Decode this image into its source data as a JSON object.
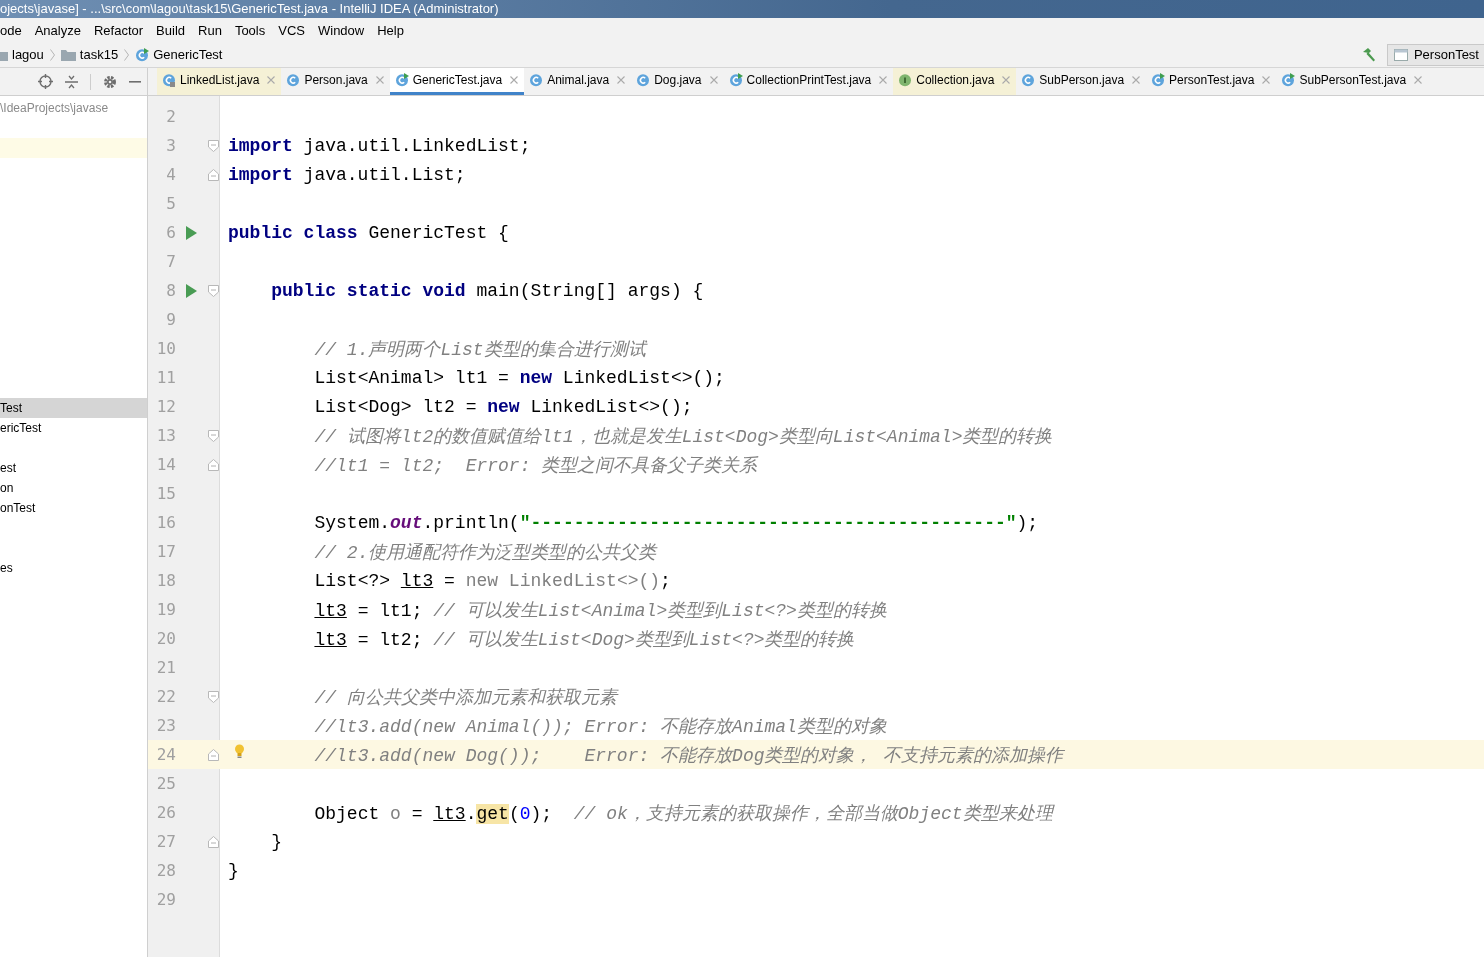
{
  "window": {
    "title": "ojects\\javase] - ...\\src\\com\\lagou\\task15\\GenericTest.java - IntelliJ IDEA (Administrator)"
  },
  "menu": [
    "ode",
    "Analyze",
    "Refactor",
    "Build",
    "Run",
    "Tools",
    "VCS",
    "Window",
    "Help"
  ],
  "breadcrumbs": [
    {
      "label": "lagou",
      "kind": "folder"
    },
    {
      "label": "task15",
      "kind": "folder"
    },
    {
      "label": "GenericTest",
      "kind": "runnable"
    }
  ],
  "run_config": {
    "label": "PersonTest"
  },
  "tabs": [
    {
      "label": "LinkedList.java",
      "kind": "locked",
      "library": true,
      "selected": false
    },
    {
      "label": "Person.java",
      "kind": "class",
      "library": false,
      "selected": false
    },
    {
      "label": "GenericTest.java",
      "kind": "runnable",
      "library": false,
      "selected": true
    },
    {
      "label": "Animal.java",
      "kind": "class",
      "library": false,
      "selected": false
    },
    {
      "label": "Dog.java",
      "kind": "class",
      "library": false,
      "selected": false
    },
    {
      "label": "CollectionPrintTest.java",
      "kind": "runnable",
      "library": false,
      "selected": false
    },
    {
      "label": "Collection.java",
      "kind": "interface",
      "library": true,
      "selected": false
    },
    {
      "label": "SubPerson.java",
      "kind": "class",
      "library": false,
      "selected": false
    },
    {
      "label": "PersonTest.java",
      "kind": "runnable",
      "library": false,
      "selected": false
    },
    {
      "label": "SubPersonTest.java",
      "kind": "runnable",
      "library": false,
      "selected": false
    }
  ],
  "sidebar": {
    "path": "\\IdeaProjects\\javase",
    "rows": [
      {
        "selected": false,
        "highlighted": true
      },
      {
        "label": "Test",
        "selected": true,
        "highlighted": false
      },
      {
        "label": "ericTest",
        "selected": false,
        "highlighted": false
      },
      {
        "label": "est",
        "selected": false,
        "highlighted": false
      },
      {
        "label": "on",
        "selected": false,
        "highlighted": false
      },
      {
        "label": "onTest",
        "selected": false,
        "highlighted": false
      },
      {
        "label": "es",
        "selected": false,
        "highlighted": false
      }
    ]
  },
  "code": {
    "lines": [
      {
        "number": "2",
        "run": false,
        "current": false,
        "bulb": false,
        "fold_start": false,
        "fold_end": false
      },
      {
        "number": "3",
        "run": false,
        "current": false,
        "bulb": false,
        "fold_start": true,
        "fold_end": false,
        "tokens": [
          {
            "t": "import",
            "kind": "kw"
          },
          {
            "t": " java.util.LinkedList;",
            "kind": "p"
          }
        ]
      },
      {
        "number": "4",
        "run": false,
        "current": false,
        "bulb": false,
        "fold_start": false,
        "fold_end": true,
        "tokens": [
          {
            "t": "import",
            "kind": "kw"
          },
          {
            "t": " java.util.List;",
            "kind": "p"
          }
        ]
      },
      {
        "number": "5",
        "run": false,
        "current": false,
        "bulb": false,
        "fold_start": false,
        "fold_end": false
      },
      {
        "number": "6",
        "run": true,
        "current": false,
        "bulb": false,
        "fold_start": false,
        "fold_end": false,
        "tokens": [
          {
            "t": "public class",
            "kind": "kw"
          },
          {
            "t": " GenericTest {",
            "kind": "p"
          }
        ]
      },
      {
        "number": "7",
        "run": false,
        "current": false,
        "bulb": false,
        "fold_start": false,
        "fold_end": false
      },
      {
        "number": "8",
        "run": true,
        "current": false,
        "bulb": false,
        "fold_start": true,
        "fold_end": false,
        "tokens": [
          {
            "t": "    public static void",
            "kind": "kw"
          },
          {
            "t": " main(String[] args) {",
            "kind": "p"
          }
        ]
      },
      {
        "number": "9",
        "run": false,
        "current": false,
        "bulb": false,
        "fold_start": false,
        "fold_end": false
      },
      {
        "number": "10",
        "run": false,
        "current": false,
        "bulb": false,
        "fold_start": false,
        "fold_end": false,
        "tokens": [
          {
            "t": "        // 1.声明两个List类型的集合进行测试",
            "kind": "c"
          }
        ]
      },
      {
        "number": "11",
        "run": false,
        "current": false,
        "bulb": false,
        "fold_start": false,
        "fold_end": false,
        "tokens": [
          {
            "t": "        List<Animal> lt1 = ",
            "kind": "p"
          },
          {
            "t": "new",
            "kind": "kw"
          },
          {
            "t": " LinkedList<>();",
            "kind": "p"
          }
        ]
      },
      {
        "number": "12",
        "run": false,
        "current": false,
        "bulb": false,
        "fold_start": false,
        "fold_end": false,
        "tokens": [
          {
            "t": "        List<Dog> lt2 = ",
            "kind": "p"
          },
          {
            "t": "new",
            "kind": "kw"
          },
          {
            "t": " LinkedList<>();",
            "kind": "p"
          }
        ]
      },
      {
        "number": "13",
        "run": false,
        "current": false,
        "bulb": false,
        "fold_start": true,
        "fold_end": false,
        "tokens": [
          {
            "t": "        // 试图将lt2的数值赋值给lt1，也就是发生List<Dog>类型向List<Animal>类型的转换",
            "kind": "c"
          }
        ]
      },
      {
        "number": "14",
        "run": false,
        "current": false,
        "bulb": false,
        "fold_start": false,
        "fold_end": true,
        "tokens": [
          {
            "t": "        //lt1 = lt2;  Error: 类型之间不具备父子类关系",
            "kind": "c"
          }
        ]
      },
      {
        "number": "15",
        "run": false,
        "current": false,
        "bulb": false,
        "fold_start": false,
        "fold_end": false
      },
      {
        "number": "16",
        "run": false,
        "current": false,
        "bulb": false,
        "fold_start": false,
        "fold_end": false,
        "tokens": [
          {
            "t": "        System.",
            "kind": "p"
          },
          {
            "t": "out",
            "kind": "f"
          },
          {
            "t": ".println(",
            "kind": "p"
          },
          {
            "t": "\"--------------------------------------------\"",
            "kind": "s"
          },
          {
            "t": ");",
            "kind": "p"
          }
        ]
      },
      {
        "number": "17",
        "run": false,
        "current": false,
        "bulb": false,
        "fold_start": false,
        "fold_end": false,
        "tokens": [
          {
            "t": "        // 2.使用通配符作为泛型类型的公共父类",
            "kind": "c"
          }
        ]
      },
      {
        "number": "18",
        "run": false,
        "current": false,
        "bulb": false,
        "fold_start": false,
        "fold_end": false,
        "tokens": [
          {
            "t": "        List<?> ",
            "kind": "p"
          },
          {
            "t": "lt3",
            "kind": "ul"
          },
          {
            "t": " = ",
            "kind": "p"
          },
          {
            "t": "new LinkedList<>()",
            "kind": "dim"
          },
          {
            "t": ";",
            "kind": "p"
          }
        ]
      },
      {
        "number": "19",
        "run": false,
        "current": false,
        "bulb": false,
        "fold_start": false,
        "fold_end": false,
        "tokens": [
          {
            "t": "        lt3",
            "kind": "ul"
          },
          {
            "t": " = lt1; ",
            "kind": "p"
          },
          {
            "t": "// 可以发生List<Animal>类型到List<?>类型的转换",
            "kind": "c"
          }
        ]
      },
      {
        "number": "20",
        "run": false,
        "current": false,
        "bulb": false,
        "fold_start": false,
        "fold_end": false,
        "tokens": [
          {
            "t": "        lt3",
            "kind": "ul"
          },
          {
            "t": " = lt2; ",
            "kind": "p"
          },
          {
            "t": "// 可以发生List<Dog>类型到List<?>类型的转换",
            "kind": "c"
          }
        ]
      },
      {
        "number": "21",
        "run": false,
        "current": false,
        "bulb": false,
        "fold_start": false,
        "fold_end": false
      },
      {
        "number": "22",
        "run": false,
        "current": false,
        "bulb": false,
        "fold_start": true,
        "fold_end": false,
        "tokens": [
          {
            "t": "        // 向公共父类中添加元素和获取元素",
            "kind": "c"
          }
        ]
      },
      {
        "number": "23",
        "run": false,
        "current": false,
        "bulb": false,
        "fold_start": false,
        "fold_end": false,
        "tokens": [
          {
            "t": "        //lt3.add(new Animal()); Error: 不能存放Animal类型的对象",
            "kind": "c"
          }
        ]
      },
      {
        "number": "24",
        "run": false,
        "current": true,
        "bulb": true,
        "fold_start": false,
        "fold_end": true,
        "tokens": [
          {
            "t": "        //lt3.add(new Dog());    Error: 不能存放Dog类型的对象， 不支持元素的添加操作",
            "kind": "c"
          }
        ]
      },
      {
        "number": "25",
        "run": false,
        "current": false,
        "bulb": false,
        "fold_start": false,
        "fold_end": false
      },
      {
        "number": "26",
        "run": false,
        "current": false,
        "bulb": false,
        "fold_start": false,
        "fold_end": false,
        "tokens": [
          {
            "t": "        Object ",
            "kind": "p"
          },
          {
            "t": "o",
            "kind": "dim"
          },
          {
            "t": " = ",
            "kind": "p"
          },
          {
            "t": "lt3",
            "kind": "ul"
          },
          {
            "t": ".",
            "kind": "p"
          },
          {
            "t": "get",
            "kind": "hl"
          },
          {
            "t": "(",
            "kind": "p"
          },
          {
            "t": "0",
            "kind": "n"
          },
          {
            "t": ");  ",
            "kind": "p"
          },
          {
            "t": "// ok，支持元素的获取操作，全部当做Object类型来处理",
            "kind": "c"
          }
        ]
      },
      {
        "number": "27",
        "run": false,
        "current": false,
        "bulb": false,
        "fold_start": false,
        "fold_end": true,
        "tokens": [
          {
            "t": "    }",
            "kind": "p"
          }
        ]
      },
      {
        "number": "28",
        "run": false,
        "current": false,
        "bulb": false,
        "fold_start": false,
        "fold_end": false,
        "tokens": [
          {
            "t": "}",
            "kind": "p"
          }
        ]
      },
      {
        "number": "29",
        "run": false,
        "current": false,
        "bulb": false,
        "fold_start": false,
        "fold_end": false
      }
    ]
  }
}
